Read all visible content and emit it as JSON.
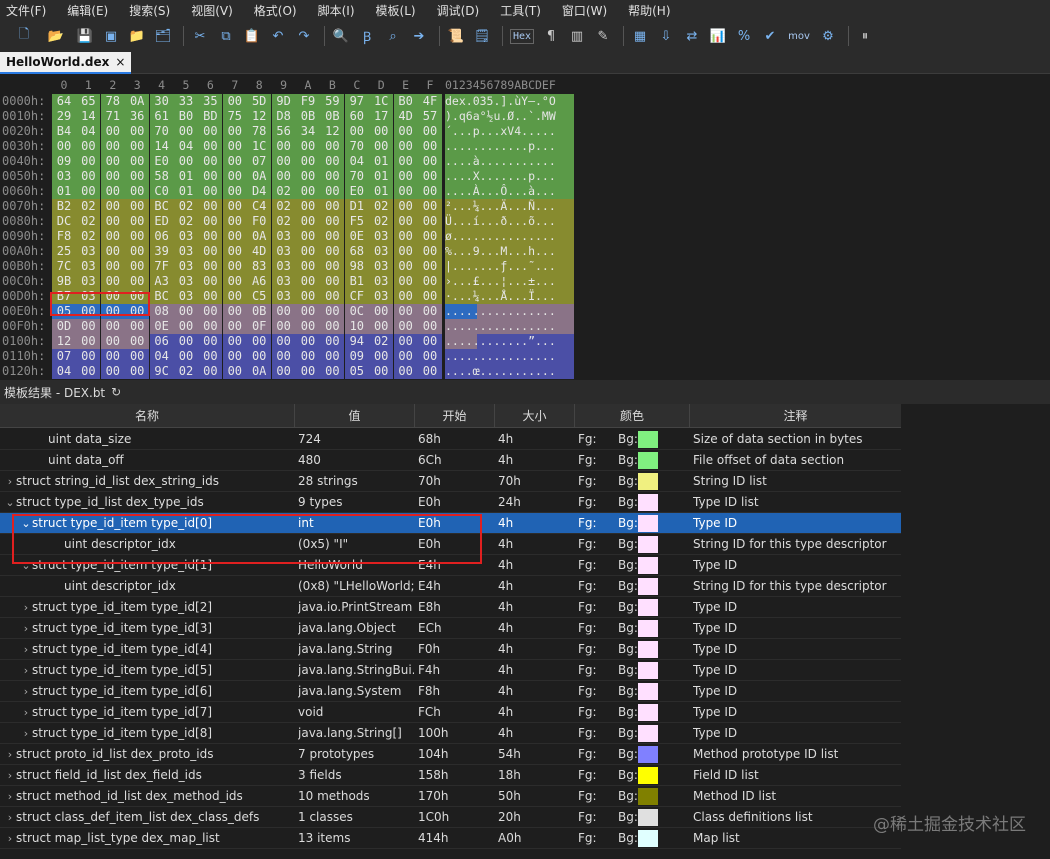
{
  "menu": [
    "文件(F)",
    "编辑(E)",
    "搜索(S)",
    "视图(V)",
    "格式(O)",
    "脚本(I)",
    "模板(L)",
    "调试(D)",
    "工具(T)",
    "窗口(W)",
    "帮助(H)"
  ],
  "toolbar": {
    "hex_label": "Hex",
    "mov_label": "mov",
    "icons": [
      "new-file-icon",
      "open-folder-icon",
      "save-icon",
      "save-all-icon",
      "folder-icon",
      "open-multiple-icon",
      "cut-icon",
      "copy-icon",
      "paste-icon",
      "undo-icon",
      "redo-icon",
      "find-icon",
      "replace-icon",
      "find-in-files-icon",
      "goto-icon",
      "script-icon",
      "template-icon",
      "hex-mode-icon",
      "pilcrow-icon",
      "columns-icon",
      "highlight-icon",
      "calculator-icon",
      "import-icon",
      "swap-icon",
      "histogram-icon",
      "percent-icon",
      "checksum-icon",
      "mov-icon",
      "binary-icon",
      "pause-icon"
    ]
  },
  "tab": {
    "label": "HelloWorld.dex",
    "close": "×"
  },
  "hex": {
    "column_headers": [
      "0",
      "1",
      "2",
      "3",
      "4",
      "5",
      "6",
      "7",
      "8",
      "9",
      "A",
      "B",
      "C",
      "D",
      "E",
      "F"
    ],
    "ascii_header": "0123456789ABCDEF",
    "colors": {
      "green": "#5b9a48",
      "olive": "#878b2f",
      "mauve": "#8a7387",
      "blue": "#4b4fa6",
      "selected": "#2d6bc0"
    },
    "rows": [
      {
        "addr": "0000h:",
        "bytes": [
          "64",
          "65",
          "78",
          "0A",
          "30",
          "33",
          "35",
          "00",
          "5D",
          "9D",
          "F9",
          "59",
          "97",
          "1C",
          "B0",
          "4F"
        ],
        "ascii": "dex.035.].ùY—.°O",
        "color": "green"
      },
      {
        "addr": "0010h:",
        "bytes": [
          "29",
          "14",
          "71",
          "36",
          "61",
          "B0",
          "BD",
          "75",
          "12",
          "D8",
          "0B",
          "0B",
          "60",
          "17",
          "4D",
          "57"
        ],
        "ascii": ").q6a°½u.Ø..`.MW",
        "color": "green"
      },
      {
        "addr": "0020h:",
        "bytes": [
          "B4",
          "04",
          "00",
          "00",
          "70",
          "00",
          "00",
          "00",
          "78",
          "56",
          "34",
          "12",
          "00",
          "00",
          "00",
          "00"
        ],
        "ascii": "´...p...xV4.....",
        "color": "green"
      },
      {
        "addr": "0030h:",
        "bytes": [
          "00",
          "00",
          "00",
          "00",
          "14",
          "04",
          "00",
          "00",
          "1C",
          "00",
          "00",
          "00",
          "70",
          "00",
          "00",
          "00"
        ],
        "ascii": "............p...",
        "color": "green"
      },
      {
        "addr": "0040h:",
        "bytes": [
          "09",
          "00",
          "00",
          "00",
          "E0",
          "00",
          "00",
          "00",
          "07",
          "00",
          "00",
          "00",
          "04",
          "01",
          "00",
          "00"
        ],
        "ascii": "....à...........",
        "color": "green"
      },
      {
        "addr": "0050h:",
        "bytes": [
          "03",
          "00",
          "00",
          "00",
          "58",
          "01",
          "00",
          "00",
          "0A",
          "00",
          "00",
          "00",
          "70",
          "01",
          "00",
          "00"
        ],
        "ascii": "....X.......p...",
        "color": "green"
      },
      {
        "addr": "0060h:",
        "bytes": [
          "01",
          "00",
          "00",
          "00",
          "C0",
          "01",
          "00",
          "00",
          "D4",
          "02",
          "00",
          "00",
          "E0",
          "01",
          "00",
          "00"
        ],
        "ascii": "....À...Ô...à...",
        "color": "green"
      },
      {
        "addr": "0070h:",
        "bytes": [
          "B2",
          "02",
          "00",
          "00",
          "BC",
          "02",
          "00",
          "00",
          "C4",
          "02",
          "00",
          "00",
          "D1",
          "02",
          "00",
          "00"
        ],
        "ascii": "²...¼...Ä...Ñ...",
        "color": "olive"
      },
      {
        "addr": "0080h:",
        "bytes": [
          "DC",
          "02",
          "00",
          "00",
          "ED",
          "02",
          "00",
          "00",
          "F0",
          "02",
          "00",
          "00",
          "F5",
          "02",
          "00",
          "00"
        ],
        "ascii": "Ü...í...ð...õ...",
        "color": "olive"
      },
      {
        "addr": "0090h:",
        "bytes": [
          "F8",
          "02",
          "00",
          "00",
          "06",
          "03",
          "00",
          "00",
          "0A",
          "03",
          "00",
          "00",
          "0E",
          "03",
          "00",
          "00"
        ],
        "ascii": "ø...............",
        "color": "olive"
      },
      {
        "addr": "00A0h:",
        "bytes": [
          "25",
          "03",
          "00",
          "00",
          "39",
          "03",
          "00",
          "00",
          "4D",
          "03",
          "00",
          "00",
          "68",
          "03",
          "00",
          "00"
        ],
        "ascii": "%...9...M...h...",
        "color": "olive"
      },
      {
        "addr": "00B0h:",
        "bytes": [
          "7C",
          "03",
          "00",
          "00",
          "7F",
          "03",
          "00",
          "00",
          "83",
          "03",
          "00",
          "00",
          "98",
          "03",
          "00",
          "00"
        ],
        "ascii": "|.......ƒ...˜...",
        "color": "olive"
      },
      {
        "addr": "00C0h:",
        "bytes": [
          "9B",
          "03",
          "00",
          "00",
          "A3",
          "03",
          "00",
          "00",
          "A6",
          "03",
          "00",
          "00",
          "B1",
          "03",
          "00",
          "00"
        ],
        "ascii": "›...£...¦...±...",
        "color": "olive"
      },
      {
        "addr": "00D0h:",
        "bytes": [
          "B7",
          "03",
          "00",
          "00",
          "BC",
          "03",
          "00",
          "00",
          "C5",
          "03",
          "00",
          "00",
          "CF",
          "03",
          "00",
          "00"
        ],
        "ascii": "·...¼...Å...Ï...",
        "color": "olive"
      },
      {
        "addr": "00E0h:",
        "bytes": [
          "05",
          "00",
          "00",
          "00",
          "08",
          "00",
          "00",
          "00",
          "0B",
          "00",
          "00",
          "00",
          "0C",
          "00",
          "00",
          "00"
        ],
        "ascii": "................",
        "color": "mauve",
        "selected_count": 4
      },
      {
        "addr": "00F0h:",
        "bytes": [
          "0D",
          "00",
          "00",
          "00",
          "0E",
          "00",
          "00",
          "00",
          "0F",
          "00",
          "00",
          "00",
          "10",
          "00",
          "00",
          "00"
        ],
        "ascii": "................",
        "color": "mauve"
      },
      {
        "addr": "0100h:",
        "bytes": [
          "12",
          "00",
          "00",
          "00",
          "06",
          "00",
          "00",
          "00",
          "00",
          "00",
          "00",
          "00",
          "94",
          "02",
          "00",
          "00"
        ],
        "ascii": "............”...",
        "color": "mauve",
        "blue_from": 4
      },
      {
        "addr": "0110h:",
        "bytes": [
          "07",
          "00",
          "00",
          "00",
          "04",
          "00",
          "00",
          "00",
          "00",
          "00",
          "00",
          "00",
          "09",
          "00",
          "00",
          "00"
        ],
        "ascii": "................",
        "color": "blue"
      },
      {
        "addr": "0120h:",
        "bytes": [
          "04",
          "00",
          "00",
          "00",
          "9C",
          "02",
          "00",
          "00",
          "0A",
          "00",
          "00",
          "00",
          "05",
          "00",
          "00",
          "00"
        ],
        "ascii": "....œ...........",
        "color": "blue"
      }
    ]
  },
  "template": {
    "title": "模板结果 - DEX.bt",
    "headers": {
      "name": "名称",
      "value": "值",
      "start": "开始",
      "size": "大小",
      "color": "颜色",
      "comment": "注释"
    },
    "fg_label": "Fg:",
    "bg_label": "Bg:",
    "rows": [
      {
        "indent": 2,
        "toggle": "",
        "name": "uint data_size",
        "value": "724",
        "start": "68h",
        "size": "4h",
        "swatch": "#80f080",
        "comment": "Size of data section in bytes"
      },
      {
        "indent": 2,
        "toggle": "",
        "name": "uint data_off",
        "value": "480",
        "start": "6Ch",
        "size": "4h",
        "swatch": "#80f080",
        "comment": "File offset of data section"
      },
      {
        "indent": 0,
        "toggle": "›",
        "name": "struct string_id_list dex_string_ids",
        "value": "28 strings",
        "start": "70h",
        "size": "70h",
        "swatch": "#f0f080",
        "comment": "String ID list"
      },
      {
        "indent": 0,
        "toggle": "⌄",
        "name": "struct type_id_list dex_type_ids",
        "value": "9 types",
        "start": "E0h",
        "size": "24h",
        "swatch": "#ffe0ff",
        "comment": "Type ID list"
      },
      {
        "indent": 1,
        "toggle": "⌄",
        "name": "struct type_id_item type_id[0]",
        "value": "int",
        "start": "E0h",
        "size": "4h",
        "swatch": "#ffe0ff",
        "comment": "Type ID",
        "selected": true
      },
      {
        "indent": 3,
        "toggle": "",
        "name": "uint descriptor_idx",
        "value": "(0x5) \"I\"",
        "start": "E0h",
        "size": "4h",
        "swatch": "#ffe0ff",
        "comment": "String ID for this type descriptor"
      },
      {
        "indent": 1,
        "toggle": "⌄",
        "name": "struct type_id_item type_id[1]",
        "value": "HelloWorld",
        "start": "E4h",
        "size": "4h",
        "swatch": "#ffe0ff",
        "comment": "Type ID"
      },
      {
        "indent": 3,
        "toggle": "",
        "name": "uint descriptor_idx",
        "value": "(0x8) \"LHelloWorld;\"",
        "start": "E4h",
        "size": "4h",
        "swatch": "#ffe0ff",
        "comment": "String ID for this type descriptor"
      },
      {
        "indent": 1,
        "toggle": "›",
        "name": "struct type_id_item type_id[2]",
        "value": "java.io.PrintStream",
        "start": "E8h",
        "size": "4h",
        "swatch": "#ffe0ff",
        "comment": "Type ID"
      },
      {
        "indent": 1,
        "toggle": "›",
        "name": "struct type_id_item type_id[3]",
        "value": "java.lang.Object",
        "start": "ECh",
        "size": "4h",
        "swatch": "#ffe0ff",
        "comment": "Type ID"
      },
      {
        "indent": 1,
        "toggle": "›",
        "name": "struct type_id_item type_id[4]",
        "value": "java.lang.String",
        "start": "F0h",
        "size": "4h",
        "swatch": "#ffe0ff",
        "comment": "Type ID"
      },
      {
        "indent": 1,
        "toggle": "›",
        "name": "struct type_id_item type_id[5]",
        "value": "java.lang.StringBui...",
        "start": "F4h",
        "size": "4h",
        "swatch": "#ffe0ff",
        "comment": "Type ID"
      },
      {
        "indent": 1,
        "toggle": "›",
        "name": "struct type_id_item type_id[6]",
        "value": "java.lang.System",
        "start": "F8h",
        "size": "4h",
        "swatch": "#ffe0ff",
        "comment": "Type ID"
      },
      {
        "indent": 1,
        "toggle": "›",
        "name": "struct type_id_item type_id[7]",
        "value": "void",
        "start": "FCh",
        "size": "4h",
        "swatch": "#ffe0ff",
        "comment": "Type ID"
      },
      {
        "indent": 1,
        "toggle": "›",
        "name": "struct type_id_item type_id[8]",
        "value": "java.lang.String[]",
        "start": "100h",
        "size": "4h",
        "swatch": "#ffe0ff",
        "comment": "Type ID"
      },
      {
        "indent": 0,
        "toggle": "›",
        "name": "struct proto_id_list dex_proto_ids",
        "value": "7 prototypes",
        "start": "104h",
        "size": "54h",
        "swatch": "#8080ff",
        "comment": "Method prototype ID list"
      },
      {
        "indent": 0,
        "toggle": "›",
        "name": "struct field_id_list dex_field_ids",
        "value": "3 fields",
        "start": "158h",
        "size": "18h",
        "swatch": "#ffff00",
        "comment": "Field ID list"
      },
      {
        "indent": 0,
        "toggle": "›",
        "name": "struct method_id_list dex_method_ids",
        "value": "10 methods",
        "start": "170h",
        "size": "50h",
        "swatch": "#808000",
        "comment": "Method ID list"
      },
      {
        "indent": 0,
        "toggle": "›",
        "name": "struct class_def_item_list dex_class_defs",
        "value": "1 classes",
        "start": "1C0h",
        "size": "20h",
        "swatch": "#e0e0e0",
        "comment": "Class definitions list"
      },
      {
        "indent": 0,
        "toggle": "›",
        "name": "struct map_list_type dex_map_list",
        "value": "13 items",
        "start": "414h",
        "size": "A0h",
        "swatch": "#e0ffff",
        "comment": "Map list"
      }
    ]
  },
  "watermark": "@稀土掘金技术社区"
}
